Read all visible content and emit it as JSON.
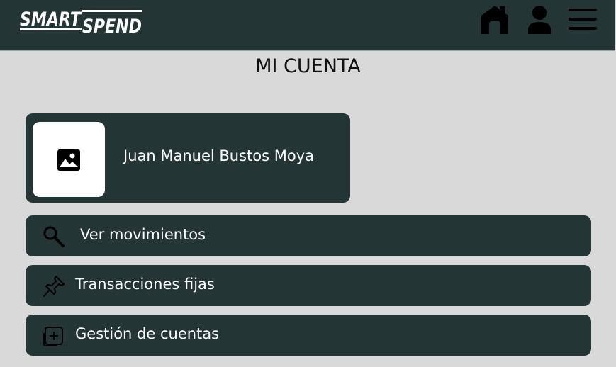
{
  "header": {
    "logo_text_top": "SMART",
    "logo_text_bottom": "SPEND",
    "icons": [
      "home-icon",
      "user-icon",
      "menu-icon"
    ]
  },
  "page": {
    "title": "MI CUENTA"
  },
  "profile": {
    "name": "Juan Manuel Bustos Moya",
    "avatar_icon": "image-icon"
  },
  "menu": [
    {
      "label": "Ver movimientos",
      "icon": "search-icon"
    },
    {
      "label": "Transacciones fijas",
      "icon": "pin-icon"
    },
    {
      "label": "Gestión de cuentas",
      "icon": "add-square-icon"
    }
  ],
  "colors": {
    "header_bg": "#243535",
    "page_bg": "#d9d9d9",
    "card_bg": "#243535",
    "text_light": "#ffffff"
  }
}
